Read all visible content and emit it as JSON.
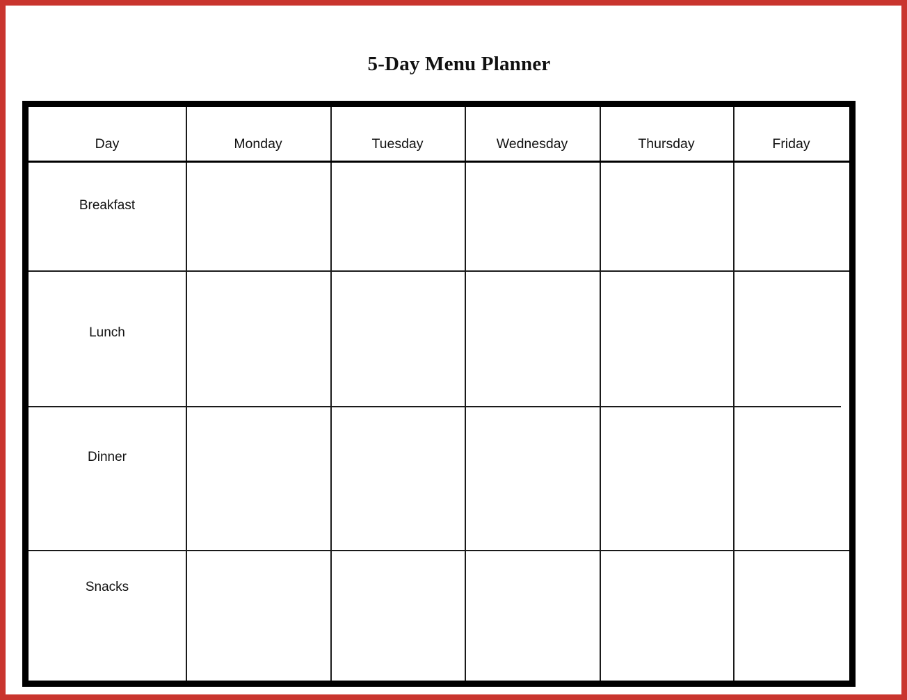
{
  "page": {
    "title": "5-Day Menu Planner",
    "border_color": "#c9352e",
    "grid_line_color": "#1a1a1a",
    "background_color": "#ffffff"
  },
  "table": {
    "columns": [
      {
        "key": "day",
        "label": "Day"
      },
      {
        "key": "monday",
        "label": "Monday"
      },
      {
        "key": "tuesday",
        "label": "Tuesday"
      },
      {
        "key": "wednesday",
        "label": "Wednesday"
      },
      {
        "key": "thursday",
        "label": "Thursday"
      },
      {
        "key": "friday",
        "label": "Friday"
      }
    ],
    "rows": [
      {
        "key": "breakfast",
        "label": "Breakfast",
        "cells": [
          "",
          "",
          "",
          "",
          ""
        ]
      },
      {
        "key": "lunch",
        "label": "Lunch",
        "cells": [
          "",
          "",
          "",
          "",
          ""
        ]
      },
      {
        "key": "dinner",
        "label": "Dinner",
        "cells": [
          "",
          "",
          "",
          "",
          ""
        ]
      },
      {
        "key": "snacks",
        "label": "Snacks",
        "cells": [
          "",
          "",
          "",
          "",
          ""
        ]
      }
    ]
  }
}
